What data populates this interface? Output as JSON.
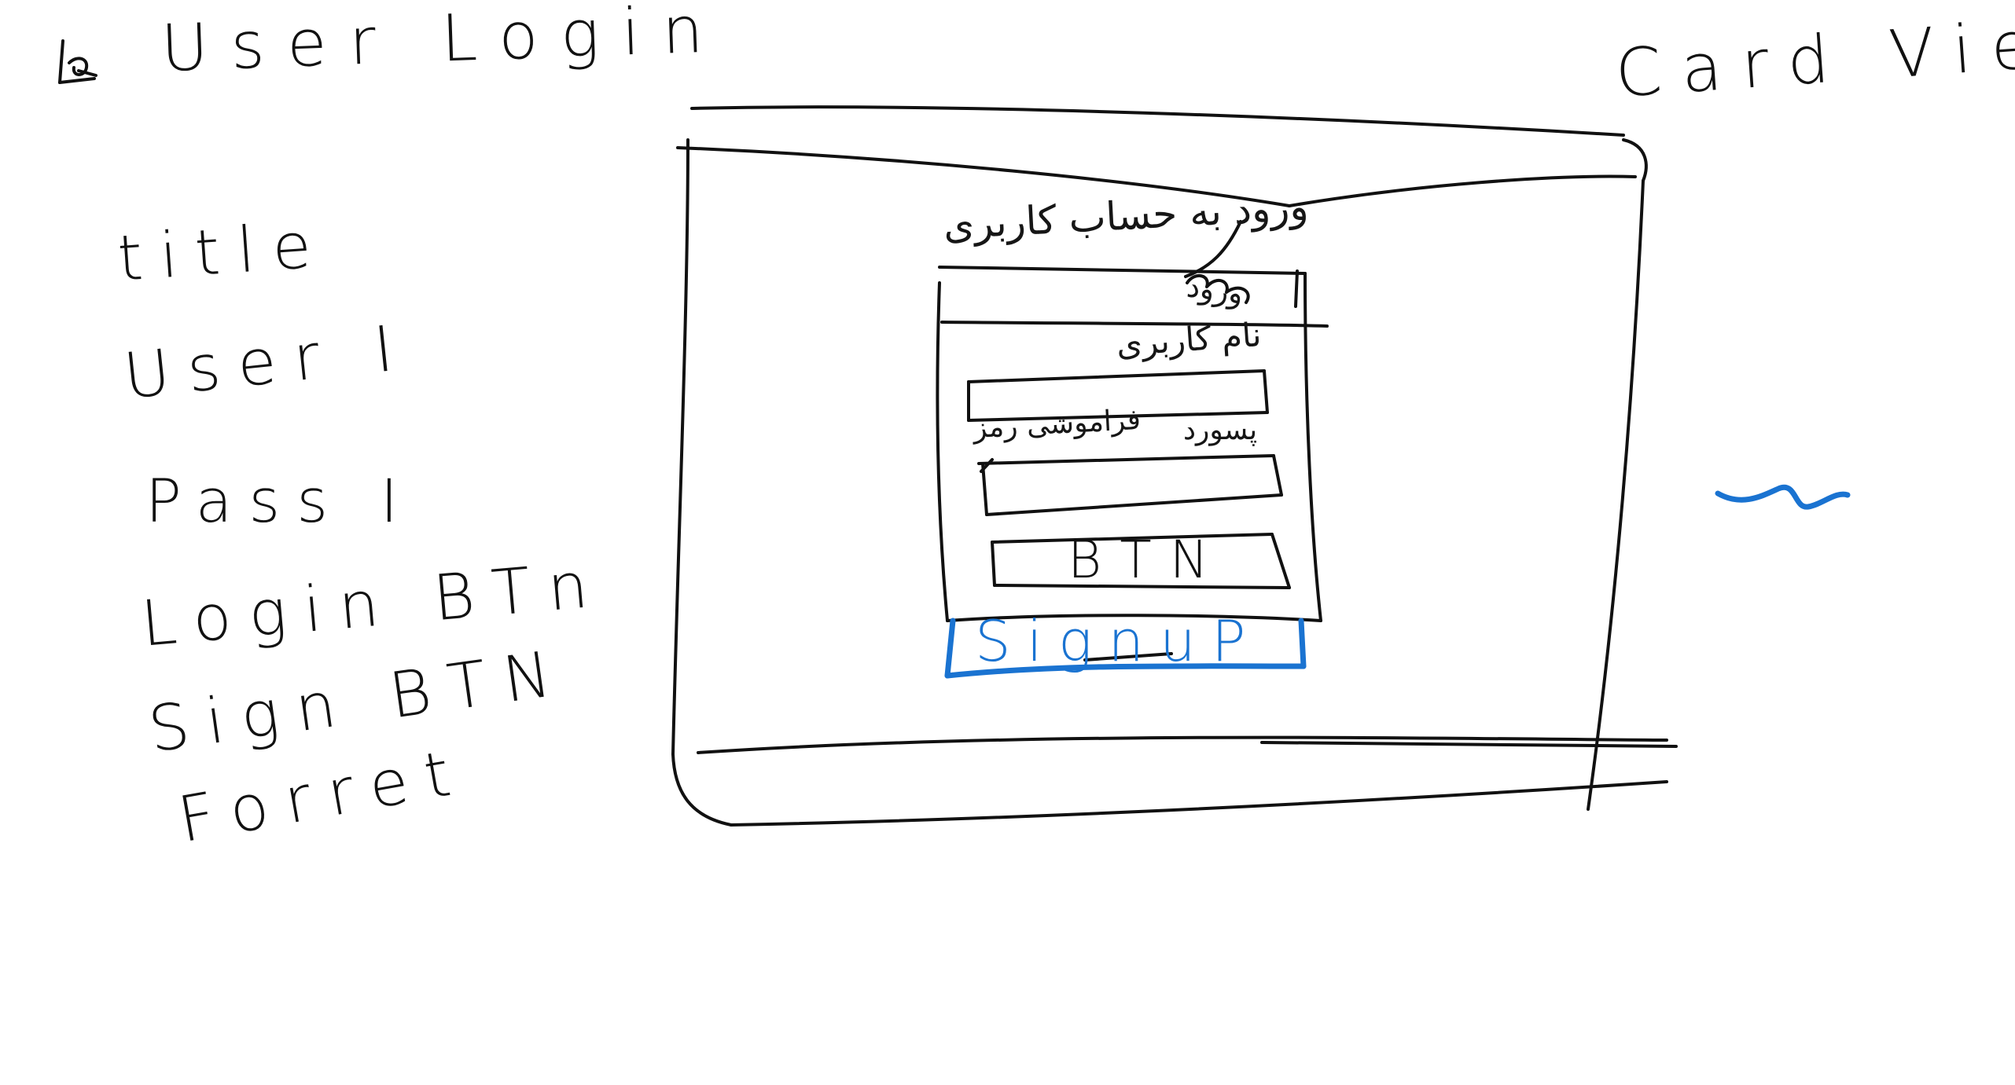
{
  "note": {
    "title": "User Login",
    "view_title": "Card View"
  },
  "component_list": [
    "title",
    "User I",
    "Pass I",
    "Login BTn",
    "Sign BTN",
    "Forret"
  ],
  "form": {
    "title_fa": "ورود به حساب کاربری",
    "header_note_fa": "ورود",
    "username_label_fa": "نام کاربری",
    "password_label_fa": "پسورد",
    "forgot_label_fa": "فراموشی رمز",
    "button_label": "BTN",
    "signup_label": "SignuP"
  },
  "colors": {
    "ink": "#111111",
    "accent": "#1a73d1",
    "background": "#ffffff"
  },
  "icons": {
    "pen_mark": "pen-scribble-icon",
    "squiggle": "blue-squiggle-icon"
  }
}
